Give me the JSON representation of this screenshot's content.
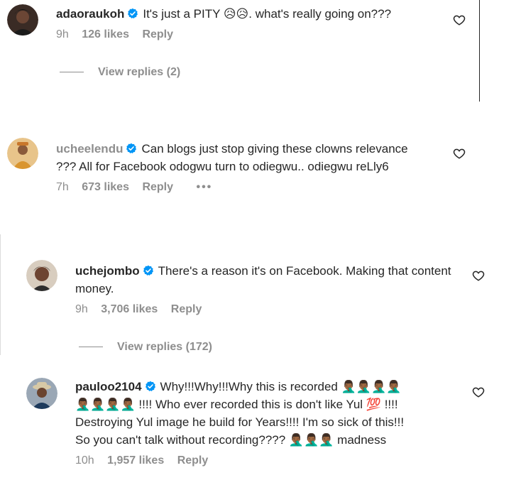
{
  "comments": [
    {
      "username": "adaoraukoh",
      "text": "It's just a PITY 😥😥. what's really going on???",
      "time": "9h",
      "likes": "126 likes",
      "reply": "Reply",
      "view_replies": "View replies (2)"
    },
    {
      "username": "ucheelendu",
      "text": "Can blogs just stop giving these clowns relevance ??? All for Facebook odogwu turn to odiegwu.. odiegwu reLly6",
      "time": "7h",
      "likes": "673 likes",
      "reply": "Reply",
      "more": "•••"
    },
    {
      "username": "uchejombo",
      "text": "There's a reason it's on Facebook. Making that content money.",
      "time": "9h",
      "likes": "3,706 likes",
      "reply": "Reply",
      "view_replies": "View replies (172)"
    },
    {
      "username": "pauloo2104",
      "text_line1": "Why!!!Why!!!Why this is recorded 🤦🏾‍♂️🤦🏾‍♂️🤦🏾‍♂️🤦🏾‍♂️",
      "text_line2": "🤦🏾‍♂️🤦🏾‍♂️🤦🏾‍♂️🤦🏾‍♂️ !!!! Who ever recorded this is don't like Yul 💯 !!!!",
      "text_line3": "Destroying Yul image he build for Years!!!! I'm so sick of this!!!",
      "text_line4": "So you can't talk without recording???? 🤦🏾‍♂️🤦🏾‍♂️🤦🏾‍♂️ madness",
      "time": "10h",
      "likes": "1,957 likes",
      "reply": "Reply"
    }
  ],
  "colors": {
    "verified": "#0095f6",
    "muted": "#8e8e8e",
    "text": "#262626"
  },
  "icons": {
    "like": "heart-outline-icon",
    "verified": "verified-badge-icon"
  }
}
